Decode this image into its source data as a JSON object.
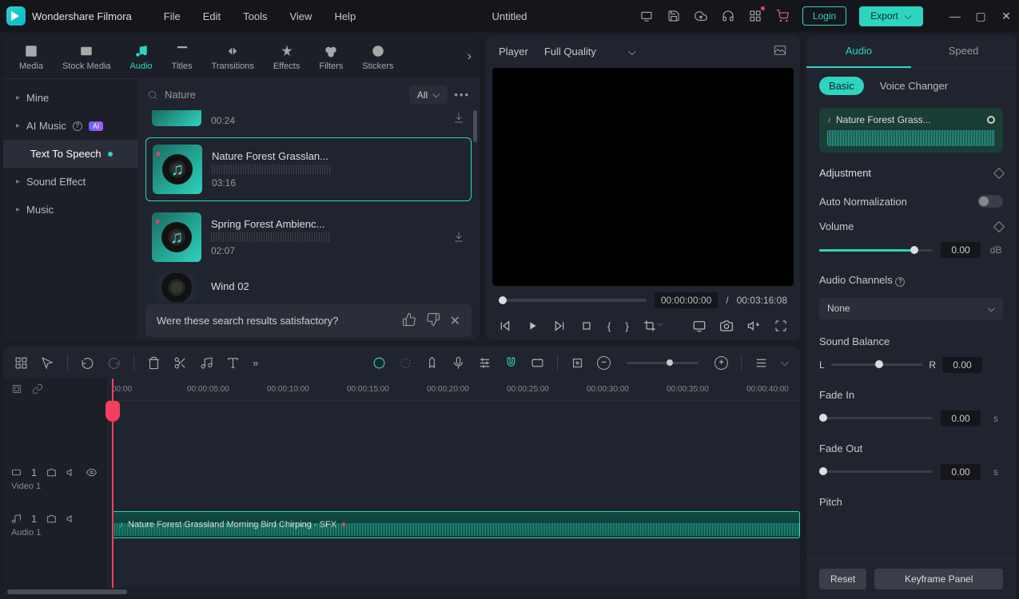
{
  "app_title": "Wondershare Filmora",
  "project_title": "Untitled",
  "menu": [
    "File",
    "Edit",
    "Tools",
    "View",
    "Help"
  ],
  "login_label": "Login",
  "export_label": "Export",
  "tabs": [
    "Media",
    "Stock Media",
    "Audio",
    "Titles",
    "Transitions",
    "Effects",
    "Filters",
    "Stickers"
  ],
  "active_tab": "Audio",
  "sidebar": {
    "items": [
      {
        "label": "Mine",
        "chev": true
      },
      {
        "label": "AI Music",
        "ai": true
      },
      {
        "label": "Text To Speech",
        "dot": true,
        "active": true
      },
      {
        "label": "Sound Effect",
        "chev": true
      },
      {
        "label": "Music",
        "chev": true
      }
    ]
  },
  "search": {
    "value": "Nature",
    "filter": "All"
  },
  "audio_items": [
    {
      "dur": "00:24",
      "partial_top": true,
      "dl": true
    },
    {
      "name": "Nature Forest Grasslan...",
      "dur": "03:16",
      "gem": true,
      "selected": true
    },
    {
      "name": "Spring Forest Ambienc...",
      "dur": "02:07",
      "gem": true,
      "dl": true
    },
    {
      "name": "Wind 02",
      "partial_bottom": true,
      "dark": true
    }
  ],
  "feedback": "Were these search results satisfactory?",
  "player": {
    "label": "Player",
    "quality": "Full Quality",
    "current": "00:00:00:00",
    "total": "00:03:16:08",
    "sep": "/"
  },
  "right": {
    "tabs": [
      "Audio",
      "Speed"
    ],
    "active_tab": "Audio",
    "sub_tabs": [
      "Basic",
      "Voice Changer"
    ],
    "active_sub": "Basic",
    "clip_name": "Nature Forest Grass...",
    "adjustment_label": "Adjustment",
    "auto_norm": "Auto Normalization",
    "volume": {
      "label": "Volume",
      "value": "0.00",
      "unit": "dB"
    },
    "channels": {
      "label": "Audio Channels",
      "value": "None"
    },
    "balance": {
      "label": "Sound Balance",
      "L": "L",
      "R": "R",
      "value": "0.00"
    },
    "fade_in": {
      "label": "Fade In",
      "value": "0.00",
      "unit": "s"
    },
    "fade_out": {
      "label": "Fade Out",
      "value": "0.00",
      "unit": "s"
    },
    "pitch": "Pitch",
    "reset": "Reset",
    "keyframe": "Keyframe Panel"
  },
  "timeline": {
    "ruler": [
      "00:00",
      "00:00:05:00",
      "00:00:10:00",
      "00:00:15:00",
      "00:00:20:00",
      "00:00:25:00",
      "00:00:30:00",
      "00:00:35:00",
      "00:00:40:00"
    ],
    "video_track": {
      "num": "1",
      "label": "Video 1"
    },
    "audio_track": {
      "num": "1",
      "label": "Audio 1"
    },
    "clip_label": "Nature Forest Grassland Morning Bird Chirping - SFX"
  }
}
